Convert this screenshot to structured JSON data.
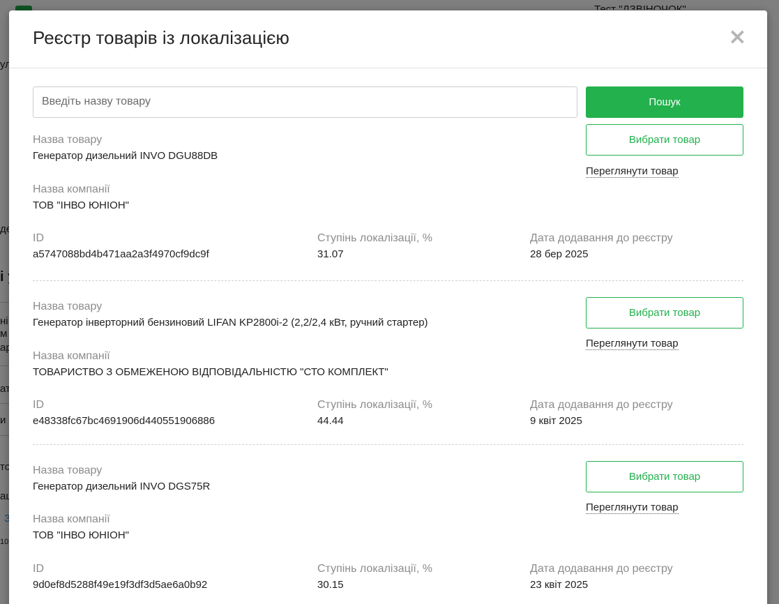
{
  "background": {
    "header_right_text": "Тест \"ДЗВІНОЧОК\"",
    "fragments": [
      "ул",
      "де",
      "і у",
      "ні",
      "м Д",
      "ар",
      "ат",
      "и",
      "то",
      "аш",
      "З",
      "10("
    ]
  },
  "modal": {
    "title": "Реєстр товарів із локалізацією",
    "close_symbol": "×",
    "search": {
      "placeholder": "Введіть назву товару",
      "button_label": "Пошук"
    },
    "labels": {
      "product_name": "Назва товару",
      "company_name": "Назва компанії",
      "id": "ID",
      "localization": "Ступінь локалізації, %",
      "date_added": "Дата додавання до реєстру",
      "select_button": "Вибрати товар",
      "view_link": "Переглянути товар"
    },
    "products": [
      {
        "name": "Генератор дизельний INVO DGU88DB",
        "company": "ТОВ \"ІНВО ЮНІОН\"",
        "id": "a5747088bd4b471aa2a3f4970cf9dc9f",
        "localization": "31.07",
        "date_added": "28 бер 2025"
      },
      {
        "name": "Генератор інверторний бензиновий LIFAN KP2800i-2 (2,2/2,4 кВт, ручний стартер)",
        "company": "ТОВАРИСТВО З ОБМЕЖЕНОЮ ВІДПОВІДАЛЬНІСТЮ \"СТО КОМПЛЕКТ\"",
        "id": "e48338fc67bc4691906d440551906886",
        "localization": "44.44",
        "date_added": "9 квіт 2025"
      },
      {
        "name": "Генератор дизельний INVO DGS75R",
        "company": "ТОВ \"ІНВО ЮНІОН\"",
        "id": "9d0ef8d5288f49e19f3df3d5ae6a0b92",
        "localization": "30.15",
        "date_added": "23 квіт 2025"
      }
    ]
  },
  "colors": {
    "accent": "#22b14c",
    "overlay": "rgba(0,0,0,0.5)",
    "label": "#8c8c8c",
    "text": "#222222"
  }
}
